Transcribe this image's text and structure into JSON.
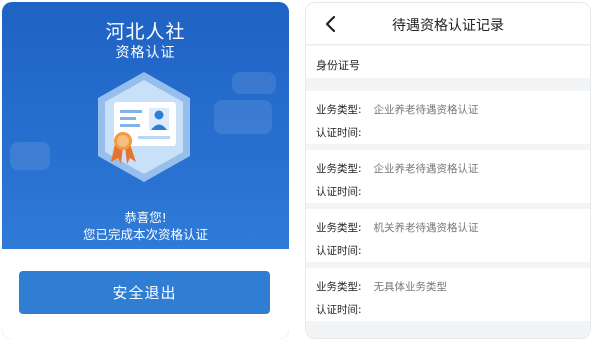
{
  "left_screen": {
    "app_title": "河北人社",
    "subtitle": "资格认证",
    "congrats_line1": "恭喜您!",
    "congrats_line2": "您已完成本次资格认证",
    "exit_button": "安全退出",
    "colors": {
      "background": "#2169c9",
      "button": "#2f7ed3"
    }
  },
  "right_screen": {
    "page_title": "待遇资格认证记录",
    "back_icon": "chevron-left-icon",
    "id_label": "身份证号",
    "type_label": "业务类型:",
    "time_label": "认证时间:",
    "records": [
      {
        "type": "企业养老待遇资格认证",
        "time": ""
      },
      {
        "type": "企业养老待遇资格认证",
        "time": ""
      },
      {
        "type": "机关养老待遇资格认证",
        "time": ""
      },
      {
        "type": "无具体业务类型",
        "time": ""
      }
    ]
  }
}
